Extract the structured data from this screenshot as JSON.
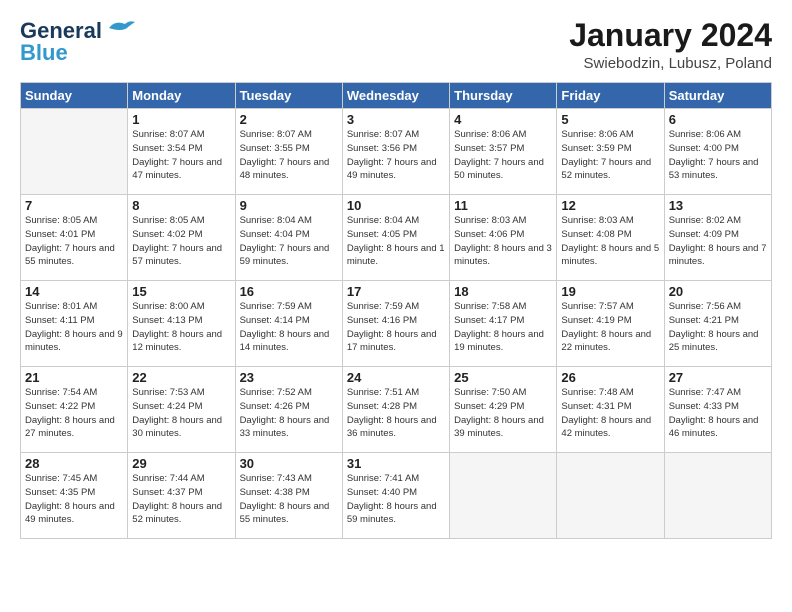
{
  "logo": {
    "line1": "General",
    "line2": "Blue"
  },
  "title": "January 2024",
  "subtitle": "Swiebodzin, Lubusz, Poland",
  "days_of_week": [
    "Sunday",
    "Monday",
    "Tuesday",
    "Wednesday",
    "Thursday",
    "Friday",
    "Saturday"
  ],
  "weeks": [
    [
      {
        "day": "",
        "empty": true
      },
      {
        "day": "1",
        "sunrise": "Sunrise: 8:07 AM",
        "sunset": "Sunset: 3:54 PM",
        "daylight": "Daylight: 7 hours and 47 minutes."
      },
      {
        "day": "2",
        "sunrise": "Sunrise: 8:07 AM",
        "sunset": "Sunset: 3:55 PM",
        "daylight": "Daylight: 7 hours and 48 minutes."
      },
      {
        "day": "3",
        "sunrise": "Sunrise: 8:07 AM",
        "sunset": "Sunset: 3:56 PM",
        "daylight": "Daylight: 7 hours and 49 minutes."
      },
      {
        "day": "4",
        "sunrise": "Sunrise: 8:06 AM",
        "sunset": "Sunset: 3:57 PM",
        "daylight": "Daylight: 7 hours and 50 minutes."
      },
      {
        "day": "5",
        "sunrise": "Sunrise: 8:06 AM",
        "sunset": "Sunset: 3:59 PM",
        "daylight": "Daylight: 7 hours and 52 minutes."
      },
      {
        "day": "6",
        "sunrise": "Sunrise: 8:06 AM",
        "sunset": "Sunset: 4:00 PM",
        "daylight": "Daylight: 7 hours and 53 minutes."
      }
    ],
    [
      {
        "day": "7",
        "sunrise": "Sunrise: 8:05 AM",
        "sunset": "Sunset: 4:01 PM",
        "daylight": "Daylight: 7 hours and 55 minutes."
      },
      {
        "day": "8",
        "sunrise": "Sunrise: 8:05 AM",
        "sunset": "Sunset: 4:02 PM",
        "daylight": "Daylight: 7 hours and 57 minutes."
      },
      {
        "day": "9",
        "sunrise": "Sunrise: 8:04 AM",
        "sunset": "Sunset: 4:04 PM",
        "daylight": "Daylight: 7 hours and 59 minutes."
      },
      {
        "day": "10",
        "sunrise": "Sunrise: 8:04 AM",
        "sunset": "Sunset: 4:05 PM",
        "daylight": "Daylight: 8 hours and 1 minute."
      },
      {
        "day": "11",
        "sunrise": "Sunrise: 8:03 AM",
        "sunset": "Sunset: 4:06 PM",
        "daylight": "Daylight: 8 hours and 3 minutes."
      },
      {
        "day": "12",
        "sunrise": "Sunrise: 8:03 AM",
        "sunset": "Sunset: 4:08 PM",
        "daylight": "Daylight: 8 hours and 5 minutes."
      },
      {
        "day": "13",
        "sunrise": "Sunrise: 8:02 AM",
        "sunset": "Sunset: 4:09 PM",
        "daylight": "Daylight: 8 hours and 7 minutes."
      }
    ],
    [
      {
        "day": "14",
        "sunrise": "Sunrise: 8:01 AM",
        "sunset": "Sunset: 4:11 PM",
        "daylight": "Daylight: 8 hours and 9 minutes."
      },
      {
        "day": "15",
        "sunrise": "Sunrise: 8:00 AM",
        "sunset": "Sunset: 4:13 PM",
        "daylight": "Daylight: 8 hours and 12 minutes."
      },
      {
        "day": "16",
        "sunrise": "Sunrise: 7:59 AM",
        "sunset": "Sunset: 4:14 PM",
        "daylight": "Daylight: 8 hours and 14 minutes."
      },
      {
        "day": "17",
        "sunrise": "Sunrise: 7:59 AM",
        "sunset": "Sunset: 4:16 PM",
        "daylight": "Daylight: 8 hours and 17 minutes."
      },
      {
        "day": "18",
        "sunrise": "Sunrise: 7:58 AM",
        "sunset": "Sunset: 4:17 PM",
        "daylight": "Daylight: 8 hours and 19 minutes."
      },
      {
        "day": "19",
        "sunrise": "Sunrise: 7:57 AM",
        "sunset": "Sunset: 4:19 PM",
        "daylight": "Daylight: 8 hours and 22 minutes."
      },
      {
        "day": "20",
        "sunrise": "Sunrise: 7:56 AM",
        "sunset": "Sunset: 4:21 PM",
        "daylight": "Daylight: 8 hours and 25 minutes."
      }
    ],
    [
      {
        "day": "21",
        "sunrise": "Sunrise: 7:54 AM",
        "sunset": "Sunset: 4:22 PM",
        "daylight": "Daylight: 8 hours and 27 minutes."
      },
      {
        "day": "22",
        "sunrise": "Sunrise: 7:53 AM",
        "sunset": "Sunset: 4:24 PM",
        "daylight": "Daylight: 8 hours and 30 minutes."
      },
      {
        "day": "23",
        "sunrise": "Sunrise: 7:52 AM",
        "sunset": "Sunset: 4:26 PM",
        "daylight": "Daylight: 8 hours and 33 minutes."
      },
      {
        "day": "24",
        "sunrise": "Sunrise: 7:51 AM",
        "sunset": "Sunset: 4:28 PM",
        "daylight": "Daylight: 8 hours and 36 minutes."
      },
      {
        "day": "25",
        "sunrise": "Sunrise: 7:50 AM",
        "sunset": "Sunset: 4:29 PM",
        "daylight": "Daylight: 8 hours and 39 minutes."
      },
      {
        "day": "26",
        "sunrise": "Sunrise: 7:48 AM",
        "sunset": "Sunset: 4:31 PM",
        "daylight": "Daylight: 8 hours and 42 minutes."
      },
      {
        "day": "27",
        "sunrise": "Sunrise: 7:47 AM",
        "sunset": "Sunset: 4:33 PM",
        "daylight": "Daylight: 8 hours and 46 minutes."
      }
    ],
    [
      {
        "day": "28",
        "sunrise": "Sunrise: 7:45 AM",
        "sunset": "Sunset: 4:35 PM",
        "daylight": "Daylight: 8 hours and 49 minutes."
      },
      {
        "day": "29",
        "sunrise": "Sunrise: 7:44 AM",
        "sunset": "Sunset: 4:37 PM",
        "daylight": "Daylight: 8 hours and 52 minutes."
      },
      {
        "day": "30",
        "sunrise": "Sunrise: 7:43 AM",
        "sunset": "Sunset: 4:38 PM",
        "daylight": "Daylight: 8 hours and 55 minutes."
      },
      {
        "day": "31",
        "sunrise": "Sunrise: 7:41 AM",
        "sunset": "Sunset: 4:40 PM",
        "daylight": "Daylight: 8 hours and 59 minutes."
      },
      {
        "day": "",
        "empty": true
      },
      {
        "day": "",
        "empty": true
      },
      {
        "day": "",
        "empty": true
      }
    ]
  ]
}
